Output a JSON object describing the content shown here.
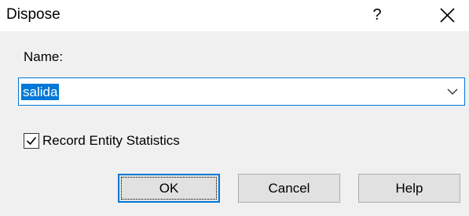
{
  "dialog": {
    "title": "Dispose",
    "help_glyph": "?",
    "close_icon": "close-icon"
  },
  "form": {
    "name_label": "Name:",
    "name_value": "salida",
    "combo_icon": "chevron-down-icon",
    "record_stats_label": "Record Entity Statistics",
    "record_stats_checked": true
  },
  "buttons": {
    "ok_label": "OK",
    "cancel_label": "Cancel",
    "help_label": "Help"
  },
  "colors": {
    "accent": "#0078d7",
    "dialog_bg": "#f0f0f0",
    "button_bg": "#e1e1e1"
  }
}
